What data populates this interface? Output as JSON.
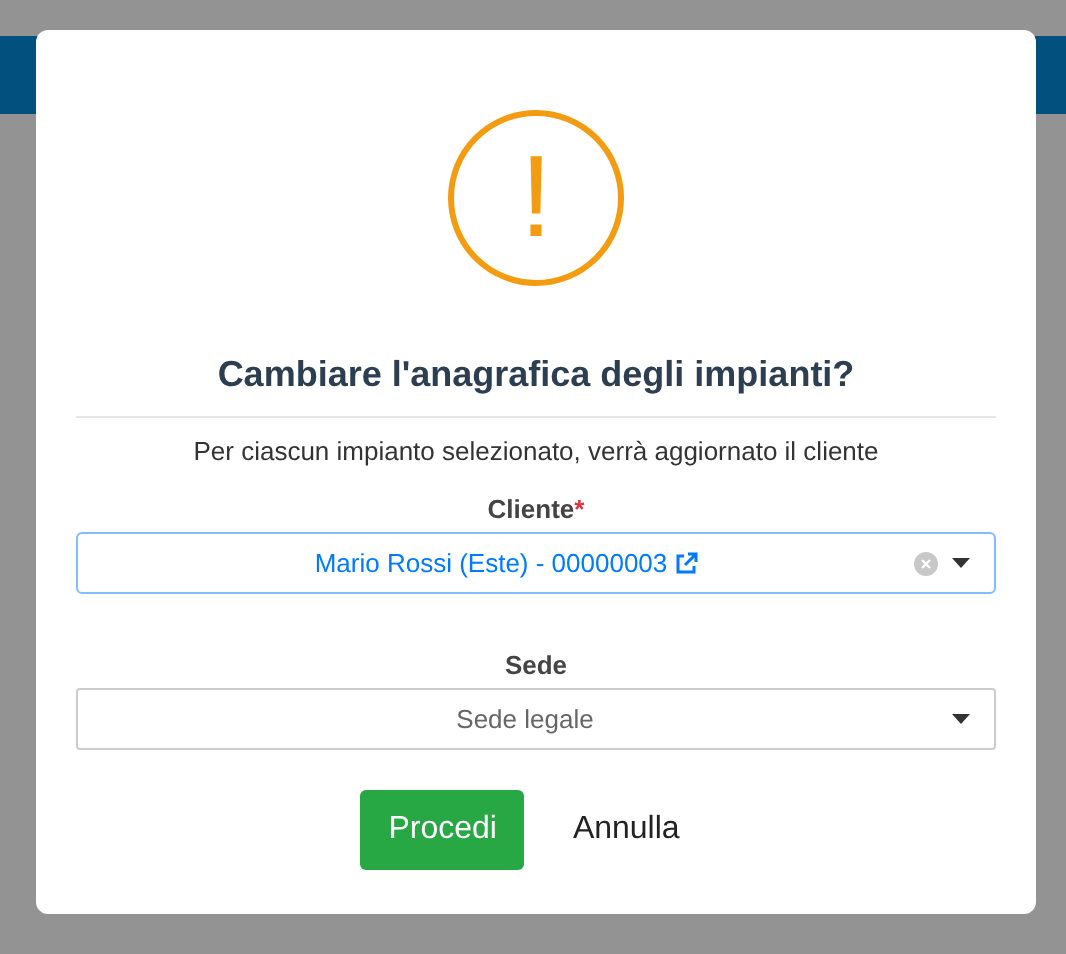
{
  "dialog": {
    "icon": "!",
    "title": "Cambiare l'anagrafica degli impianti?",
    "message": "Per ciascun impianto selezionato, verrà aggiornato il cliente",
    "fields": [
      {
        "label": "Cliente",
        "required_mark": "*",
        "value": "Mario Rossi (Este) - 00000003",
        "focused": true,
        "clearable": true,
        "link": true
      },
      {
        "label": "Sede",
        "value": "Sede legale",
        "focused": false,
        "clearable": false,
        "link": false
      }
    ],
    "buttons": [
      {
        "label": "Procedi",
        "kind": "primary"
      },
      {
        "label": "Annulla",
        "kind": "plain"
      }
    ]
  }
}
